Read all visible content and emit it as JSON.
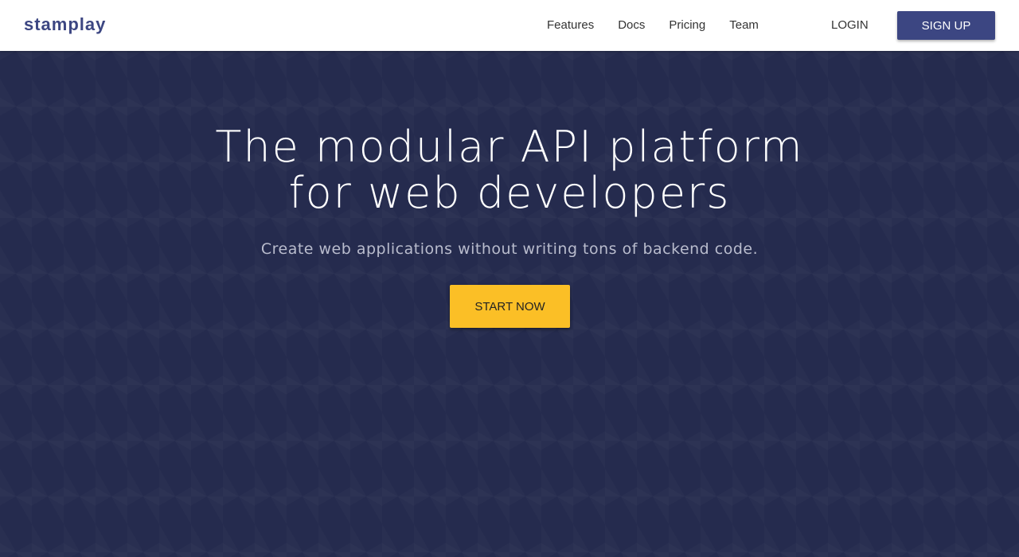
{
  "header": {
    "logo": "stamplay",
    "nav": [
      {
        "label": "Features"
      },
      {
        "label": "Docs"
      },
      {
        "label": "Pricing"
      },
      {
        "label": "Team"
      }
    ],
    "login_label": "LOGIN",
    "signup_label": "SIGN UP"
  },
  "hero": {
    "title_line1": "The modular API platform",
    "title_line2": "for web developers",
    "subtitle": "Create web applications without writing tons of backend code.",
    "cta_label": "START NOW"
  },
  "colors": {
    "brand": "#3c4682",
    "hero_background": "#252b4e",
    "cta": "#fbbf26",
    "header_background": "#ffffff"
  }
}
